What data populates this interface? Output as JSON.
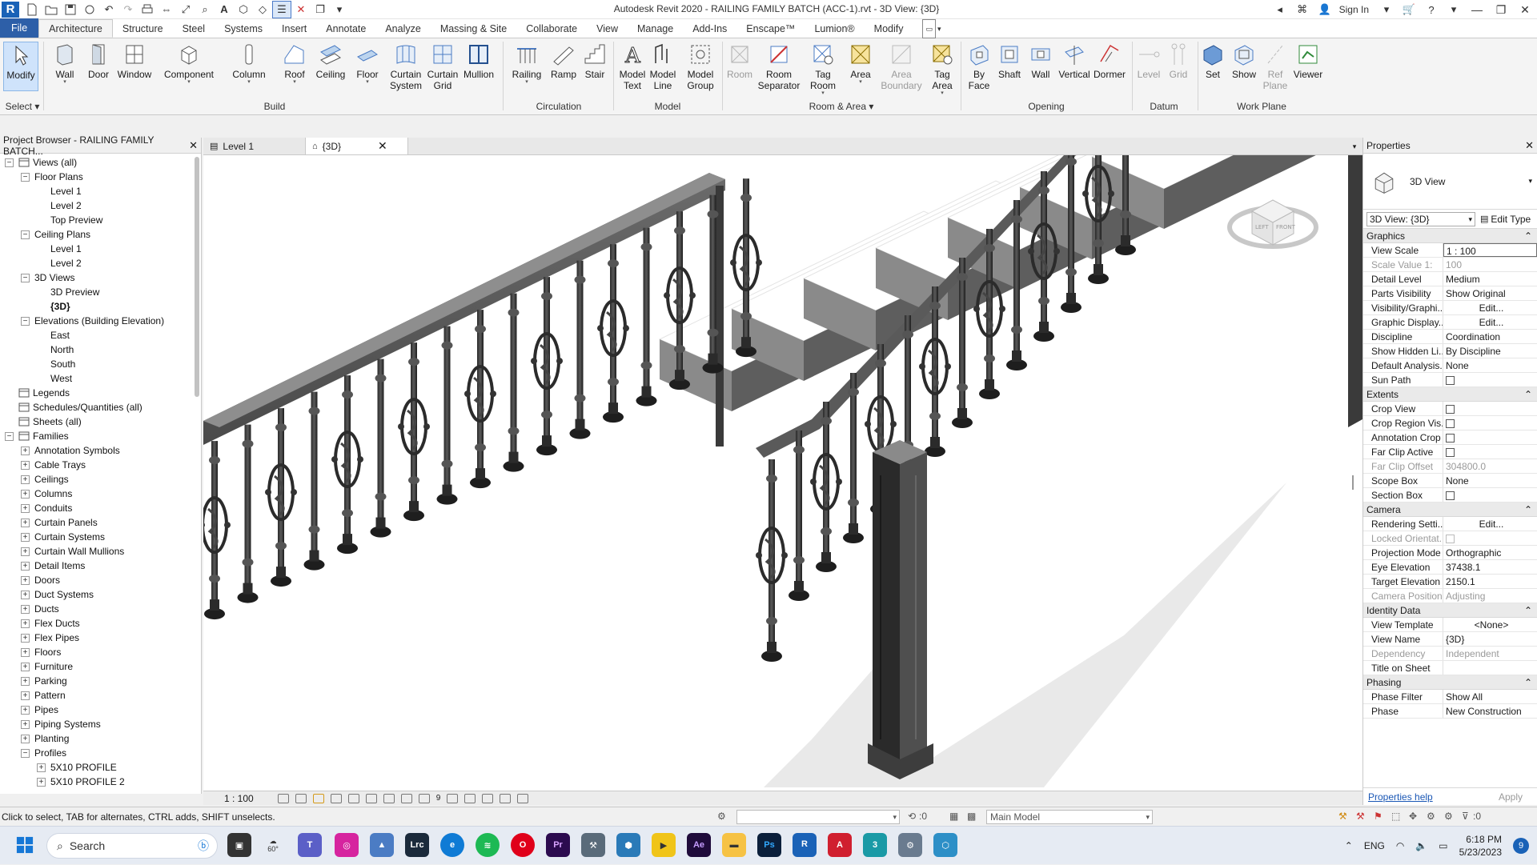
{
  "app": {
    "title": "Autodesk Revit 2020 - RAILING FAMILY BATCH (ACC-1).rvt - 3D View: {3D}",
    "sign_in": "Sign In"
  },
  "ribbon": {
    "tabs": [
      "File",
      "Architecture",
      "Structure",
      "Steel",
      "Systems",
      "Insert",
      "Annotate",
      "Analyze",
      "Massing & Site",
      "Collaborate",
      "View",
      "Manage",
      "Add-Ins",
      "Enscape™",
      "Lumion®",
      "Modify"
    ],
    "active_tab": "Architecture",
    "select_label": "Select",
    "buttons": {
      "modify": "Modify",
      "wall": "Wall",
      "door": "Door",
      "window": "Window",
      "component": "Component",
      "column": "Column",
      "roof": "Roof",
      "ceiling": "Ceiling",
      "floor": "Floor",
      "curtain_system": "Curtain\nSystem",
      "curtain_grid": "Curtain\nGrid",
      "mullion": "Mullion",
      "railing": "Railing",
      "ramp": "Ramp",
      "stair": "Stair",
      "model_text": "Model\nText",
      "model_line": "Model\nLine",
      "model_group": "Model\nGroup",
      "room": "Room",
      "room_separator": "Room\nSeparator",
      "tag_room": "Tag\nRoom",
      "area": "Area",
      "area_boundary": "Area\nBoundary",
      "tag_area": "Tag\nArea",
      "by_face": "By\nFace",
      "shaft": "Shaft",
      "wall_opening": "Wall",
      "vertical": "Vertical",
      "dormer": "Dormer",
      "level": "Level",
      "grid": "Grid",
      "set": "Set",
      "show": "Show",
      "ref_plane": "Ref\nPlane",
      "viewer": "Viewer"
    },
    "panels": {
      "build": "Build",
      "circulation": "Circulation",
      "model": "Model",
      "room_area": "Room & Area",
      "opening": "Opening",
      "datum": "Datum",
      "work_plane": "Work Plane"
    }
  },
  "project_browser": {
    "title": "Project Browser - RAILING FAMILY BATCH...",
    "tree": [
      {
        "label": "Views (all)",
        "depth": 0,
        "toggle": "-",
        "icon": "views-icon"
      },
      {
        "label": "Floor Plans",
        "depth": 1,
        "toggle": "-"
      },
      {
        "label": "Level 1",
        "depth": 2
      },
      {
        "label": "Level 2",
        "depth": 2
      },
      {
        "label": "Top Preview",
        "depth": 2
      },
      {
        "label": "Ceiling Plans",
        "depth": 1,
        "toggle": "-"
      },
      {
        "label": "Level 1",
        "depth": 2
      },
      {
        "label": "Level 2",
        "depth": 2
      },
      {
        "label": "3D Views",
        "depth": 1,
        "toggle": "-"
      },
      {
        "label": "3D Preview",
        "depth": 2
      },
      {
        "label": "{3D}",
        "depth": 2,
        "bold": true
      },
      {
        "label": "Elevations (Building Elevation)",
        "depth": 1,
        "toggle": "-"
      },
      {
        "label": "East",
        "depth": 2
      },
      {
        "label": "North",
        "depth": 2
      },
      {
        "label": "South",
        "depth": 2
      },
      {
        "label": "West",
        "depth": 2
      },
      {
        "label": "Legends",
        "depth": 0,
        "icon": "legend-icon"
      },
      {
        "label": "Schedules/Quantities (all)",
        "depth": 0,
        "icon": "schedule-icon"
      },
      {
        "label": "Sheets (all)",
        "depth": 0,
        "icon": "sheet-icon"
      },
      {
        "label": "Families",
        "depth": 0,
        "toggle": "-",
        "icon": "family-icon"
      },
      {
        "label": "Annotation Symbols",
        "depth": 1,
        "toggle": "+"
      },
      {
        "label": "Cable Trays",
        "depth": 1,
        "toggle": "+"
      },
      {
        "label": "Ceilings",
        "depth": 1,
        "toggle": "+"
      },
      {
        "label": "Columns",
        "depth": 1,
        "toggle": "+"
      },
      {
        "label": "Conduits",
        "depth": 1,
        "toggle": "+"
      },
      {
        "label": "Curtain Panels",
        "depth": 1,
        "toggle": "+"
      },
      {
        "label": "Curtain Systems",
        "depth": 1,
        "toggle": "+"
      },
      {
        "label": "Curtain Wall Mullions",
        "depth": 1,
        "toggle": "+"
      },
      {
        "label": "Detail Items",
        "depth": 1,
        "toggle": "+"
      },
      {
        "label": "Doors",
        "depth": 1,
        "toggle": "+"
      },
      {
        "label": "Duct Systems",
        "depth": 1,
        "toggle": "+"
      },
      {
        "label": "Ducts",
        "depth": 1,
        "toggle": "+"
      },
      {
        "label": "Flex Ducts",
        "depth": 1,
        "toggle": "+"
      },
      {
        "label": "Flex Pipes",
        "depth": 1,
        "toggle": "+"
      },
      {
        "label": "Floors",
        "depth": 1,
        "toggle": "+"
      },
      {
        "label": "Furniture",
        "depth": 1,
        "toggle": "+"
      },
      {
        "label": "Parking",
        "depth": 1,
        "toggle": "+"
      },
      {
        "label": "Pattern",
        "depth": 1,
        "toggle": "+"
      },
      {
        "label": "Pipes",
        "depth": 1,
        "toggle": "+"
      },
      {
        "label": "Piping Systems",
        "depth": 1,
        "toggle": "+"
      },
      {
        "label": "Planting",
        "depth": 1,
        "toggle": "+"
      },
      {
        "label": "Profiles",
        "depth": 1,
        "toggle": "-"
      },
      {
        "label": "5X10 PROFILE",
        "depth": 2,
        "toggle": "+"
      },
      {
        "label": "5X10 PROFILE 2",
        "depth": 2,
        "toggle": "+"
      }
    ]
  },
  "view_tabs": [
    {
      "label": "Level 1",
      "icon": "floor-plan-icon",
      "active": false
    },
    {
      "label": "{3D}",
      "icon": "3d-view-icon",
      "active": true
    }
  ],
  "view_bar": {
    "scale": "1 : 100",
    "count": "9"
  },
  "properties": {
    "title": "Properties",
    "type_name": "3D View",
    "instance_selector": "3D View: {3D}",
    "edit_type": "Edit Type",
    "groups": [
      {
        "name": "Graphics",
        "rows": [
          {
            "key": "View Scale",
            "value": "1 : 100",
            "style": "boxed"
          },
          {
            "key": "Scale Value    1:",
            "value": "100",
            "dim": true
          },
          {
            "key": "Detail Level",
            "value": "Medium"
          },
          {
            "key": "Parts Visibility",
            "value": "Show Original"
          },
          {
            "key": "Visibility/Graphi...",
            "value": "Edit...",
            "style": "btn"
          },
          {
            "key": "Graphic Display...",
            "value": "Edit...",
            "style": "btn"
          },
          {
            "key": "Discipline",
            "value": "Coordination"
          },
          {
            "key": "Show Hidden Li...",
            "value": "By Discipline"
          },
          {
            "key": "Default Analysis...",
            "value": "None"
          },
          {
            "key": "Sun Path",
            "check": true
          }
        ]
      },
      {
        "name": "Extents",
        "rows": [
          {
            "key": "Crop View",
            "check": true
          },
          {
            "key": "Crop Region Vis...",
            "check": true
          },
          {
            "key": "Annotation Crop",
            "check": true
          },
          {
            "key": "Far Clip Active",
            "check": true
          },
          {
            "key": "Far Clip Offset",
            "value": "304800.0",
            "dim": true
          },
          {
            "key": "Scope Box",
            "value": "None"
          },
          {
            "key": "Section Box",
            "check": true
          }
        ]
      },
      {
        "name": "Camera",
        "rows": [
          {
            "key": "Rendering Setti...",
            "value": "Edit...",
            "style": "btn"
          },
          {
            "key": "Locked Orientat...",
            "check": true,
            "dim": true
          },
          {
            "key": "Projection Mode",
            "value": "Orthographic"
          },
          {
            "key": "Eye Elevation",
            "value": "37438.1"
          },
          {
            "key": "Target Elevation",
            "value": "2150.1"
          },
          {
            "key": "Camera Position",
            "value": "Adjusting",
            "dim": true
          }
        ]
      },
      {
        "name": "Identity Data",
        "rows": [
          {
            "key": "View Template",
            "value": "<None>",
            "style": "btn"
          },
          {
            "key": "View Name",
            "value": "{3D}"
          },
          {
            "key": "Dependency",
            "value": "Independent",
            "dim": true
          },
          {
            "key": "Title on Sheet",
            "value": ""
          }
        ]
      },
      {
        "name": "Phasing",
        "rows": [
          {
            "key": "Phase Filter",
            "value": "Show All"
          },
          {
            "key": "Phase",
            "value": "New Construction"
          }
        ]
      }
    ],
    "help_link": "Properties help",
    "apply": "Apply"
  },
  "status_bar": {
    "text": "Click to select, TAB for alternates, CTRL adds, SHIFT unselects.",
    "workset_zero": ":0",
    "model_selector": "Main Model",
    "filter_count": ":0"
  },
  "taskbar": {
    "search": "Search",
    "weather": "60°",
    "language": "ENG",
    "time": "6:18 PM",
    "date": "5/23/2023",
    "notifications": "9"
  },
  "viewcube": {
    "left": "LEFT",
    "front": "FRONT"
  }
}
